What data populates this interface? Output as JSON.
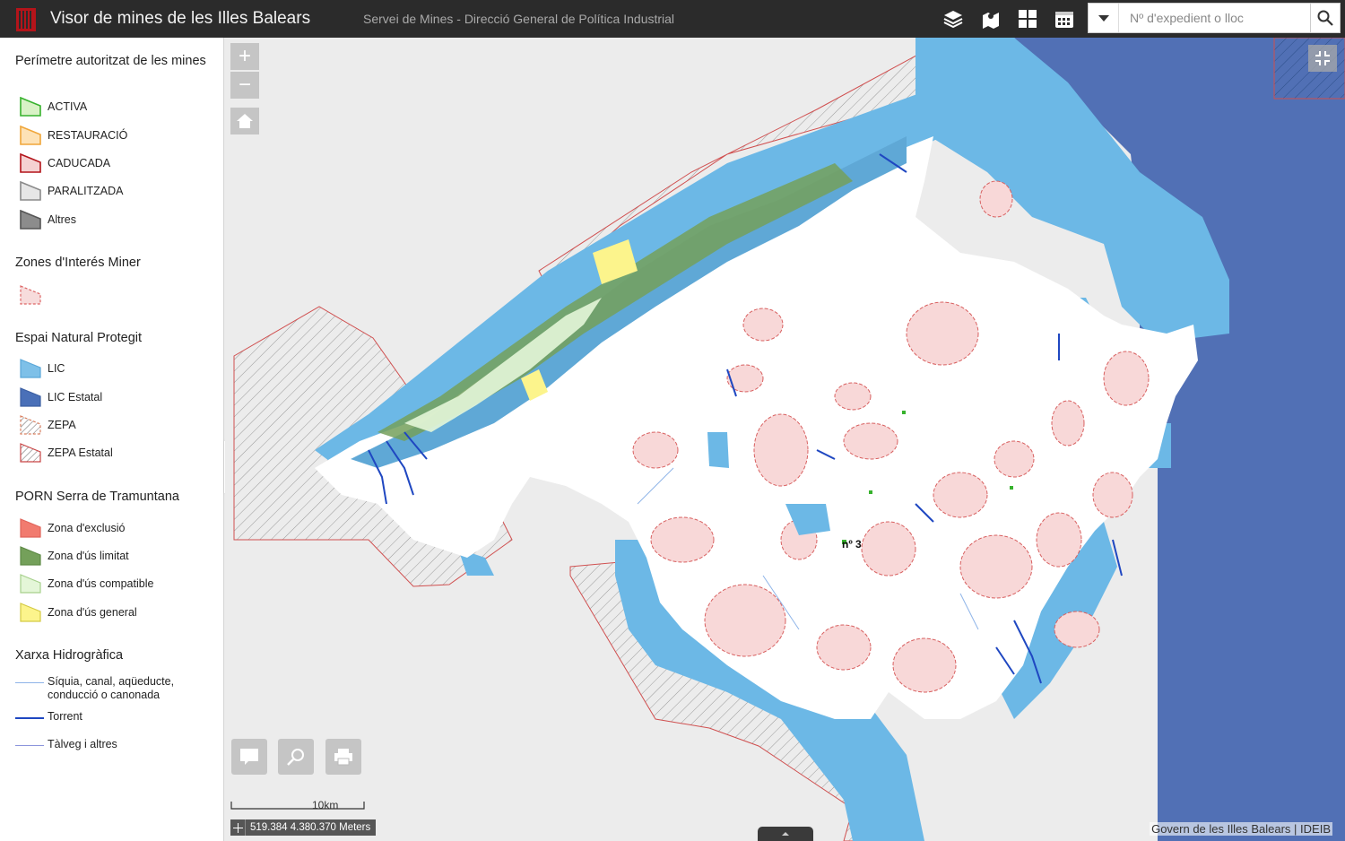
{
  "header": {
    "title": "Visor de mines de les Illes Balears",
    "subtitle": "Servei de Mines - Direcció General de Política Industrial",
    "search_placeholder": "Nº d'expedient o lloc",
    "icons": [
      "layers-icon",
      "basemap-icon",
      "grid-icon",
      "calendar-icon",
      "search-icon"
    ]
  },
  "legend": {
    "groups": [
      {
        "title": "Perímetre autoritzat de les mines",
        "items": [
          {
            "label": "ACTIVA",
            "fill": "#d9f2c6",
            "stroke": "#37b22d"
          },
          {
            "label": "RESTAURACIÓ",
            "fill": "#fde2b6",
            "stroke": "#f0a63a"
          },
          {
            "label": "CADUCADA",
            "fill": "#f5d1d1",
            "stroke": "#b3141a"
          },
          {
            "label": "PARALITZADA",
            "fill": "#e6e6e6",
            "stroke": "#8a8a8a"
          },
          {
            "label": "Altres",
            "fill": "#8c8c8c",
            "stroke": "#555555"
          }
        ]
      },
      {
        "title": "Zones d'Interés Miner",
        "items": [
          {
            "label": "",
            "fill": "#f7dcdc",
            "stroke": "#d66"
          }
        ]
      },
      {
        "title": "Espai Natural Protegit",
        "items": [
          {
            "label": "LIC",
            "fill": "#7ec0e8",
            "stroke": "#5aa7d8"
          },
          {
            "label": "LIC Estatal",
            "fill": "#4a70b8",
            "stroke": "#3c5fa2"
          },
          {
            "label": "ZEPA",
            "fill": "hatch",
            "stroke": "#d98060"
          },
          {
            "label": "ZEPA Estatal",
            "fill": "hatch",
            "stroke": "#c94545"
          }
        ]
      },
      {
        "title": "PORN Serra de Tramuntana",
        "items": [
          {
            "label": "Zona d'exclusió",
            "fill": "#f17b6f",
            "stroke": "#e0645a"
          },
          {
            "label": "Zona d'ús limitat",
            "fill": "#74a05a",
            "stroke": "#5d8a45"
          },
          {
            "label": "Zona d'ús compatible",
            "fill": "#e4f6d8",
            "stroke": "#a6d08c"
          },
          {
            "label": "Zona d'ús general",
            "fill": "#fcf48c",
            "stroke": "#d4ca44"
          }
        ]
      },
      {
        "title": "Xarxa Hidrogràfica",
        "lines": [
          {
            "label": "Síquia, canal, aqüeducte, conducció o canonada",
            "color": "#8eb4e8",
            "width": 1
          },
          {
            "label": "Torrent",
            "color": "#1f47c1",
            "width": 2
          },
          {
            "label": "Tàlveg i altres",
            "color": "#8c95dc",
            "width": 1
          }
        ]
      }
    ]
  },
  "map": {
    "scale_label": "10km",
    "coordinates": "519.384 4.380.370 Meters",
    "attribution": "Govern de les Illes Balears | IDEIB",
    "marker_label": "nº 3",
    "colors": {
      "sea": "#ececec",
      "land": "#ffffff",
      "lic": "#6cb8e6",
      "lic_estatal": "#5170b5",
      "interes": "#f8d8d8",
      "torrent": "#1f47c1"
    }
  }
}
